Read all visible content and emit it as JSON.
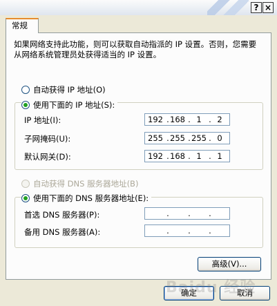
{
  "titlebar": {
    "help_label": "?",
    "close_label": "×"
  },
  "tabs": [
    {
      "label": "常规"
    }
  ],
  "intro_text": "如果网络支持此功能，则可以获取自动指派的 IP 设置。否则，您需要从网络系统管理员处获得适当的 IP 设置。",
  "ip_section": {
    "auto_ip_label": "自动获得 IP 地址(O)",
    "manual_ip_label": "使用下面的 IP 地址(S):",
    "auto_selected": false,
    "fields": [
      {
        "label": "IP 地址(I):",
        "octets": [
          "192",
          "168",
          "1",
          "2"
        ]
      },
      {
        "label": "子网掩码(U):",
        "octets": [
          "255",
          "255",
          "255",
          "0"
        ]
      },
      {
        "label": "默认网关(D):",
        "octets": [
          "192",
          "168",
          "1",
          "1"
        ]
      }
    ]
  },
  "dns_section": {
    "auto_dns_label": "自动获得 DNS 服务器地址(B)",
    "manual_dns_label": "使用下面的 DNS 服务器地址(E):",
    "fields": [
      {
        "label": "首选 DNS 服务器(P):",
        "octets": [
          "",
          "",
          "",
          ""
        ]
      },
      {
        "label": "备用 DNS 服务器(A):",
        "octets": [
          "",
          "",
          "",
          ""
        ]
      }
    ]
  },
  "buttons": {
    "advanced": "高级(V)...",
    "ok": "确定",
    "cancel": "取消"
  },
  "watermark": "Baidu 经验"
}
